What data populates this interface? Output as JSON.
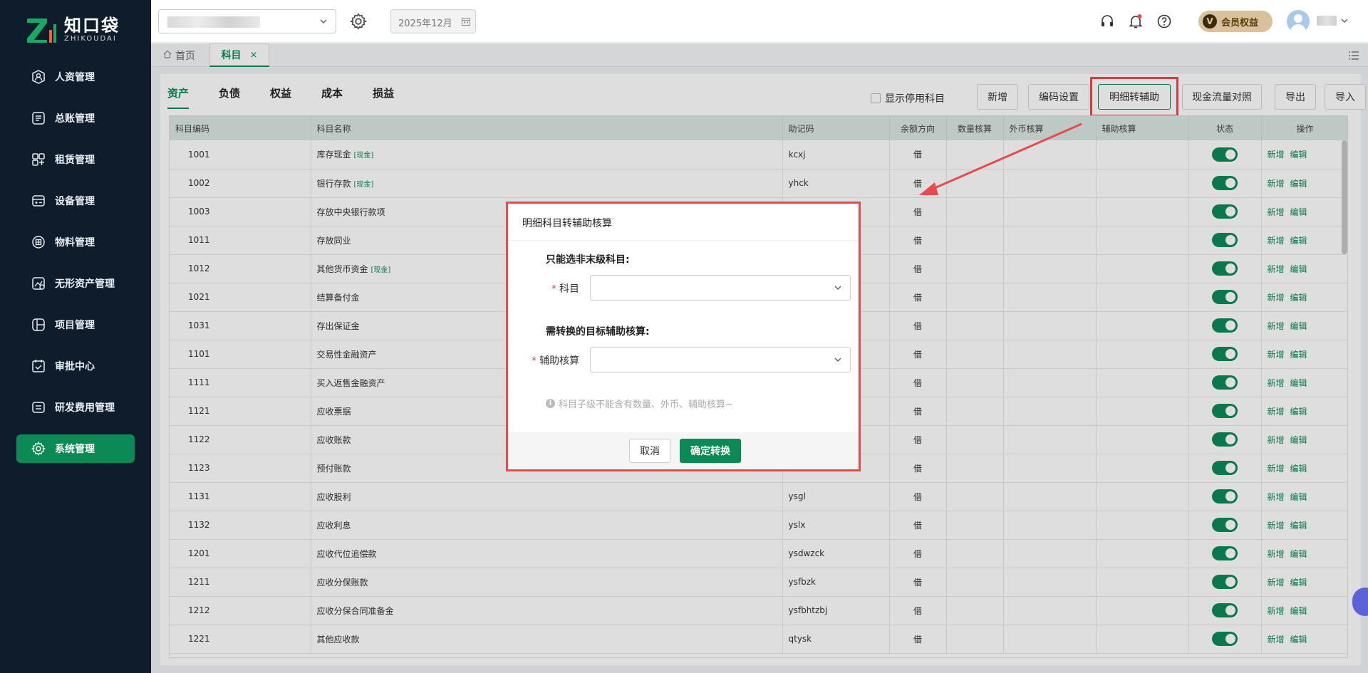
{
  "brand": {
    "name_cn": "知口袋",
    "name_en": "ZHIKOUDAI"
  },
  "sidebar": {
    "items": [
      {
        "label": "人资管理",
        "icon": "person-icon"
      },
      {
        "label": "总账管理",
        "icon": "ledger-icon"
      },
      {
        "label": "租赁管理",
        "icon": "lease-icon"
      },
      {
        "label": "设备管理",
        "icon": "device-icon"
      },
      {
        "label": "物料管理",
        "icon": "material-icon"
      },
      {
        "label": "无形资产管理",
        "icon": "intangible-asset-icon"
      },
      {
        "label": "项目管理",
        "icon": "project-icon"
      },
      {
        "label": "审批中心",
        "icon": "approval-icon"
      },
      {
        "label": "研发费用管理",
        "icon": "rd-expense-icon"
      },
      {
        "label": "系统管理",
        "icon": "gear-icon",
        "active": true
      }
    ]
  },
  "topbar": {
    "period": "2025年12月",
    "vip_label": "会员权益",
    "vip_badge": "V"
  },
  "tabs": {
    "home": "首页",
    "current": "科目",
    "close": "×"
  },
  "categories": [
    "资产",
    "负债",
    "权益",
    "成本",
    "损益"
  ],
  "toolbar": {
    "show_disabled": "显示停用科目",
    "add": "新增",
    "code_settings": "编码设置",
    "detail_to_aux": "明细转辅助",
    "cashflow_map": "现金流量对照",
    "export": "导出",
    "import": "导入"
  },
  "table": {
    "columns": [
      "科目编码",
      "科目名称",
      "助记码",
      "余额方向",
      "数量核算",
      "外币核算",
      "辅助核算",
      "状态",
      "操作"
    ],
    "op_add": "新增",
    "op_edit": "编辑",
    "rows": [
      {
        "code": "1001",
        "name": "库存现金",
        "tag": "[现金]",
        "mnemonic": "kcxj",
        "dir": "借"
      },
      {
        "code": "1002",
        "name": "银行存款",
        "tag": "[现金]",
        "mnemonic": "yhck",
        "dir": "借"
      },
      {
        "code": "1003",
        "name": "存放中央银行款项",
        "tag": "",
        "mnemonic": "",
        "dir": "借"
      },
      {
        "code": "1011",
        "name": "存放同业",
        "tag": "",
        "mnemonic": "",
        "dir": "借"
      },
      {
        "code": "1012",
        "name": "其他货币资金",
        "tag": "[现金]",
        "mnemonic": "",
        "dir": "借"
      },
      {
        "code": "1021",
        "name": "结算备付金",
        "tag": "",
        "mnemonic": "",
        "dir": "借"
      },
      {
        "code": "1031",
        "name": "存出保证金",
        "tag": "",
        "mnemonic": "",
        "dir": "借"
      },
      {
        "code": "1101",
        "name": "交易性金融资产",
        "tag": "",
        "mnemonic": "",
        "dir": "借"
      },
      {
        "code": "1111",
        "name": "买入返售金融资产",
        "tag": "",
        "mnemonic": "",
        "dir": "借"
      },
      {
        "code": "1121",
        "name": "应收票据",
        "tag": "",
        "mnemonic": "",
        "dir": "借"
      },
      {
        "code": "1122",
        "name": "应收账款",
        "tag": "",
        "mnemonic": "",
        "dir": "借"
      },
      {
        "code": "1123",
        "name": "预付账款",
        "tag": "",
        "mnemonic": "",
        "dir": "借"
      },
      {
        "code": "1131",
        "name": "应收股利",
        "tag": "",
        "mnemonic": "ysgl",
        "dir": "借"
      },
      {
        "code": "1132",
        "name": "应收利息",
        "tag": "",
        "mnemonic": "yslx",
        "dir": "借"
      },
      {
        "code": "1201",
        "name": "应收代位追偿款",
        "tag": "",
        "mnemonic": "ysdwzck",
        "dir": "借"
      },
      {
        "code": "1211",
        "name": "应收分保账款",
        "tag": "",
        "mnemonic": "ysfbzk",
        "dir": "借"
      },
      {
        "code": "1212",
        "name": "应收分保合同准备金",
        "tag": "",
        "mnemonic": "ysfbhtzbj",
        "dir": "借"
      },
      {
        "code": "1221",
        "name": "其他应收款",
        "tag": "",
        "mnemonic": "qtysk",
        "dir": "借"
      }
    ]
  },
  "modal": {
    "title": "明细科目转辅助核算",
    "section1": "只能选非末级科目:",
    "field1_label": "科目",
    "section2": "需转换的目标辅助核算:",
    "field2_label": "辅助核算",
    "required_mark": "*",
    "hint": "科目子级不能含有数量、外币、辅助核算~",
    "cancel": "取消",
    "confirm": "确定转换"
  },
  "colors": {
    "primary": "#0c8a55",
    "sidebar": "#0f1c2c",
    "annotation": "#e84b4b"
  }
}
